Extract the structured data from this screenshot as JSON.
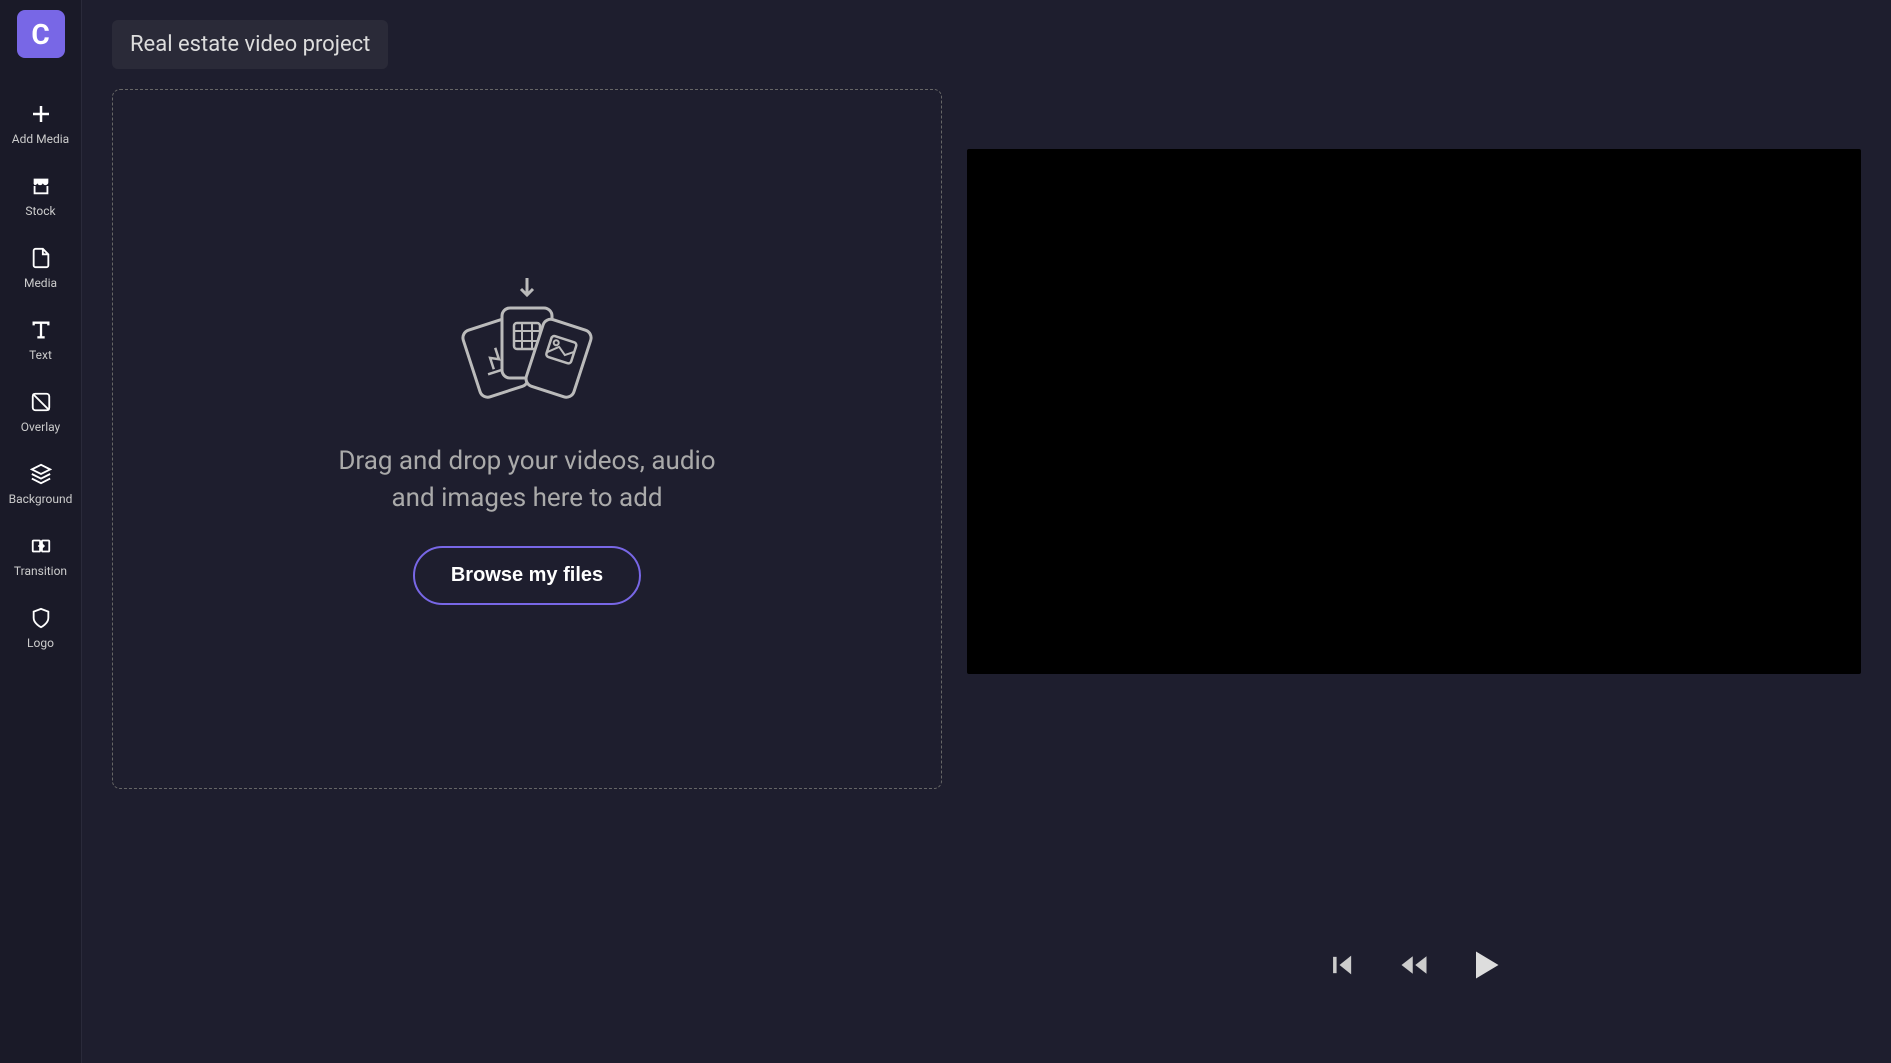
{
  "app": {
    "logo_letter": "C"
  },
  "project": {
    "title": "Real estate video project"
  },
  "sidebar": {
    "items": [
      {
        "label": "Add Media"
      },
      {
        "label": "Stock"
      },
      {
        "label": "Media"
      },
      {
        "label": "Text"
      },
      {
        "label": "Overlay"
      },
      {
        "label": "Background"
      },
      {
        "label": "Transition"
      },
      {
        "label": "Logo"
      }
    ]
  },
  "dropzone": {
    "text": "Drag and drop your videos, audio and images here to add",
    "browse_label": "Browse my files"
  },
  "colors": {
    "accent": "#7867e6",
    "background": "#1e1e2e",
    "sidebar_bg": "#1a1a28"
  }
}
